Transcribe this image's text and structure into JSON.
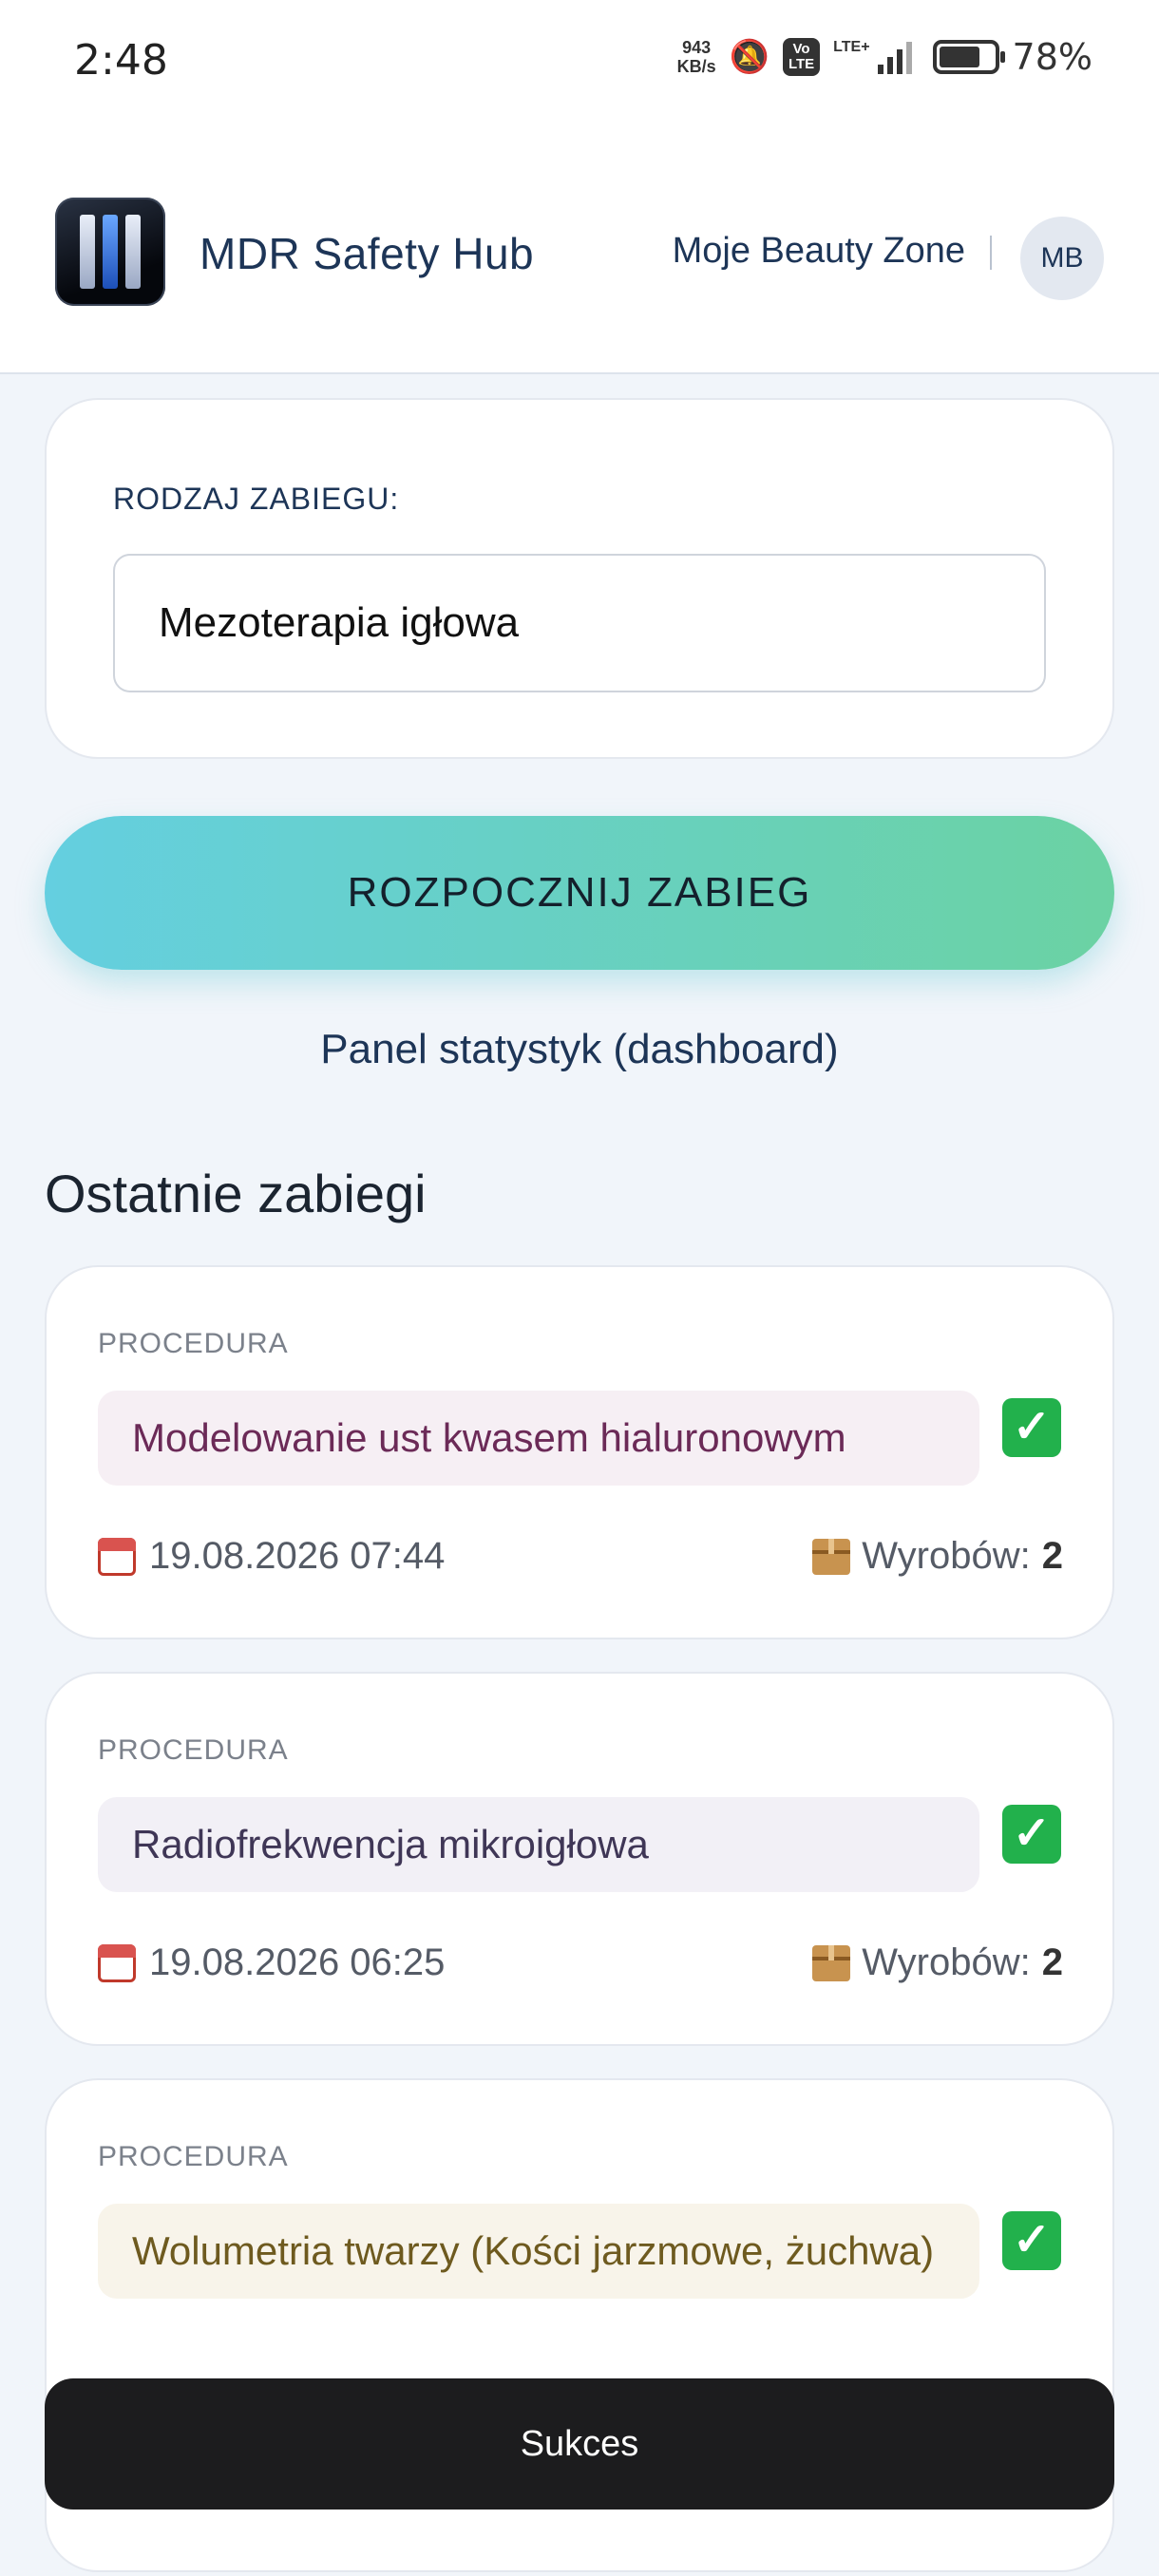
{
  "status_bar": {
    "time": "2:48",
    "speed_value": "943",
    "speed_unit": "KB/s",
    "volte_top": "Vo",
    "volte_bottom": "LTE",
    "lte": "LTE+",
    "battery_percent": 78,
    "battery_label": "78%"
  },
  "header": {
    "app_title": "MDR Safety Hub",
    "business_name": "Moje Beauty Zone",
    "avatar_initials": "MB"
  },
  "procedure_type": {
    "label": "RODZAJ ZABIEGU:",
    "value": "Mezoterapia igłowa"
  },
  "start_button": {
    "label": "ROZPOCZNIJ ZABIEG"
  },
  "dashboard_link": {
    "label": "Panel statystyk (dashboard)"
  },
  "recent": {
    "title": "Ostatnie zabiegi",
    "count_prefix": "Wyrobów:",
    "items": [
      {
        "label": "PROCEDURA",
        "name": "Modelowanie ust kwasem hialuronowym",
        "date": "19.08.2026 07:44",
        "count": "2",
        "status_icon": "check-mark-icon",
        "pill_color": "#f6eff4"
      },
      {
        "label": "PROCEDURA",
        "name": "Radiofrekwencja mikroigłowa",
        "date": "19.08.2026 06:25",
        "count": "2",
        "status_icon": "check-mark-icon",
        "pill_color": "#f2f0f6"
      },
      {
        "label": "PROCEDURA",
        "name": "Wolumetria twarzy (Kości jarzmowe, żuchwa)",
        "status_icon": "check-mark-icon",
        "pill_color": "#f8f4ea"
      }
    ]
  },
  "toast": {
    "message": "Sukces"
  },
  "colors": {
    "accent_gradient_start": "#64cfe0",
    "accent_gradient_end": "#6bd2a3",
    "primary_text": "#1d3557",
    "success": "#22b14c"
  }
}
